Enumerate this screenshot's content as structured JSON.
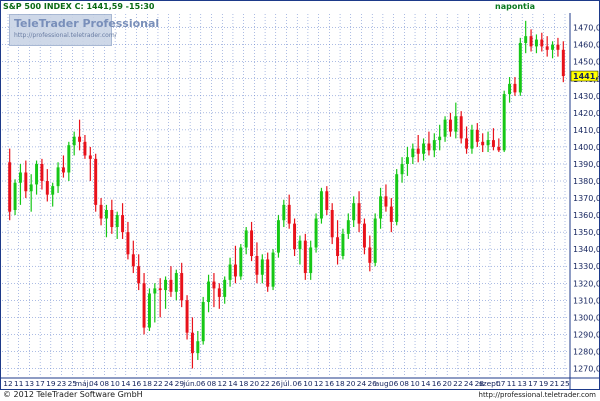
{
  "header": {
    "title": "S&P 500 INDEX C: 1441,59 -15:30",
    "period": "napontia"
  },
  "watermark": {
    "brand": "TeleTrader Professional",
    "url": "http://professional.teletrader.com/"
  },
  "footer": {
    "copyright": "© 2012 TeleTrader Software GmbH",
    "url": "http://professional.teletrader.com"
  },
  "colors": {
    "up": "#16c716",
    "down": "#e8111a",
    "grid": "#5a7ac8",
    "axis_text": "#15245e",
    "last_price_bg": "#ffff00"
  },
  "chart_data": {
    "type": "candlestick",
    "title": "S&P 500 INDEX",
    "last_price_label": "1441,59",
    "last_price": 1441.59,
    "ylim": [
      1265,
      1478
    ],
    "yticks": [
      "1270,00",
      "1280,00",
      "1290,00",
      "1300,00",
      "1310,00",
      "1320,00",
      "1330,00",
      "1340,00",
      "1350,00",
      "1360,00",
      "1370,00",
      "1380,00",
      "1390,00",
      "1400,00",
      "1410,00",
      "1420,00",
      "1430,00",
      "1440,00",
      "1450,00",
      "1460,00",
      "1470,00"
    ],
    "xticks": [
      "12",
      "11",
      "13",
      "17",
      "19",
      "23",
      "25",
      "máj.",
      "04",
      "08",
      "10",
      "14",
      "16",
      "18",
      "22",
      "24",
      "29",
      "jún.",
      "06",
      "08",
      "12",
      "14",
      "18",
      "20",
      "22",
      "26",
      "júl.",
      "06",
      "10",
      "12",
      "16",
      "18",
      "20",
      "24",
      "26",
      "aug.",
      "06",
      "08",
      "10",
      "14",
      "16",
      "20",
      "22",
      "24",
      "28",
      "szept.",
      "07",
      "11",
      "13",
      "17",
      "19",
      "21",
      "25"
    ],
    "grid": true,
    "ohlc": [
      [
        1391,
        1399,
        1357,
        1362
      ],
      [
        1363,
        1381,
        1360,
        1379
      ],
      [
        1379,
        1390,
        1366,
        1385
      ],
      [
        1385,
        1392,
        1370,
        1374
      ],
      [
        1374,
        1384,
        1362,
        1378
      ],
      [
        1378,
        1392,
        1372,
        1390
      ],
      [
        1390,
        1393,
        1375,
        1380
      ],
      [
        1380,
        1387,
        1368,
        1372
      ],
      [
        1372,
        1379,
        1365,
        1377
      ],
      [
        1377,
        1391,
        1373,
        1388
      ],
      [
        1388,
        1395,
        1382,
        1385
      ],
      [
        1385,
        1403,
        1380,
        1401
      ],
      [
        1401,
        1409,
        1395,
        1406
      ],
      [
        1406,
        1416,
        1398,
        1403
      ],
      [
        1403,
        1407,
        1393,
        1395
      ],
      [
        1395,
        1400,
        1380,
        1393
      ],
      [
        1393,
        1396,
        1362,
        1366
      ],
      [
        1366,
        1370,
        1354,
        1358
      ],
      [
        1358,
        1366,
        1347,
        1363
      ],
      [
        1363,
        1369,
        1349,
        1353
      ],
      [
        1353,
        1362,
        1346,
        1360
      ],
      [
        1360,
        1367,
        1346,
        1350
      ],
      [
        1350,
        1356,
        1334,
        1337
      ],
      [
        1337,
        1345,
        1326,
        1330
      ],
      [
        1330,
        1337,
        1316,
        1320
      ],
      [
        1320,
        1326,
        1290,
        1294
      ],
      [
        1294,
        1317,
        1292,
        1314
      ],
      [
        1314,
        1320,
        1297,
        1317
      ],
      [
        1317,
        1323,
        1300,
        1316
      ],
      [
        1316,
        1324,
        1305,
        1322
      ],
      [
        1322,
        1330,
        1312,
        1315
      ],
      [
        1315,
        1328,
        1310,
        1326
      ],
      [
        1326,
        1332,
        1306,
        1310
      ],
      [
        1310,
        1313,
        1287,
        1291
      ],
      [
        1291,
        1300,
        1270,
        1279
      ],
      [
        1279,
        1292,
        1275,
        1286
      ],
      [
        1286,
        1312,
        1284,
        1309
      ],
      [
        1309,
        1325,
        1303,
        1321
      ],
      [
        1321,
        1326,
        1306,
        1317
      ],
      [
        1317,
        1320,
        1305,
        1312
      ],
      [
        1312,
        1324,
        1308,
        1322
      ],
      [
        1322,
        1335,
        1318,
        1331
      ],
      [
        1331,
        1342,
        1320,
        1324
      ],
      [
        1324,
        1343,
        1322,
        1341
      ],
      [
        1341,
        1353,
        1337,
        1351
      ],
      [
        1351,
        1356,
        1333,
        1336
      ],
      [
        1336,
        1344,
        1320,
        1325
      ],
      [
        1325,
        1337,
        1320,
        1334
      ],
      [
        1334,
        1338,
        1315,
        1318
      ],
      [
        1318,
        1340,
        1316,
        1338
      ],
      [
        1338,
        1360,
        1335,
        1357
      ],
      [
        1357,
        1369,
        1353,
        1366
      ],
      [
        1366,
        1372,
        1352,
        1355
      ],
      [
        1355,
        1358,
        1336,
        1340
      ],
      [
        1340,
        1348,
        1331,
        1345
      ],
      [
        1345,
        1349,
        1322,
        1326
      ],
      [
        1326,
        1345,
        1322,
        1341
      ],
      [
        1341,
        1361,
        1338,
        1358
      ],
      [
        1358,
        1376,
        1355,
        1374
      ],
      [
        1374,
        1377,
        1360,
        1363
      ],
      [
        1363,
        1367,
        1343,
        1347
      ],
      [
        1347,
        1357,
        1331,
        1336
      ],
      [
        1336,
        1352,
        1334,
        1349
      ],
      [
        1349,
        1361,
        1346,
        1357
      ],
      [
        1357,
        1371,
        1353,
        1367
      ],
      [
        1367,
        1374,
        1350,
        1355
      ],
      [
        1355,
        1358,
        1337,
        1341
      ],
      [
        1341,
        1348,
        1327,
        1332
      ],
      [
        1332,
        1361,
        1330,
        1358
      ],
      [
        1358,
        1376,
        1352,
        1371
      ],
      [
        1371,
        1378,
        1362,
        1365
      ],
      [
        1365,
        1370,
        1350,
        1356
      ],
      [
        1356,
        1387,
        1354,
        1384
      ],
      [
        1384,
        1394,
        1379,
        1390
      ],
      [
        1390,
        1400,
        1383,
        1394
      ],
      [
        1394,
        1402,
        1390,
        1399
      ],
      [
        1399,
        1407,
        1391,
        1396
      ],
      [
        1396,
        1405,
        1392,
        1402
      ],
      [
        1402,
        1409,
        1395,
        1398
      ],
      [
        1398,
        1408,
        1394,
        1404
      ],
      [
        1404,
        1413,
        1398,
        1406
      ],
      [
        1406,
        1418,
        1403,
        1416
      ],
      [
        1416,
        1420,
        1406,
        1409
      ],
      [
        1409,
        1426,
        1405,
        1418
      ],
      [
        1418,
        1421,
        1402,
        1405
      ],
      [
        1405,
        1412,
        1396,
        1399
      ],
      [
        1399,
        1413,
        1396,
        1410
      ],
      [
        1410,
        1414,
        1400,
        1403
      ],
      [
        1403,
        1408,
        1397,
        1401
      ],
      [
        1401,
        1409,
        1397,
        1404
      ],
      [
        1404,
        1411,
        1398,
        1400
      ],
      [
        1400,
        1405,
        1397,
        1398
      ],
      [
        1398,
        1433,
        1397,
        1431
      ],
      [
        1431,
        1441,
        1426,
        1437
      ],
      [
        1437,
        1441,
        1430,
        1432
      ],
      [
        1432,
        1464,
        1430,
        1461
      ],
      [
        1461,
        1474,
        1455,
        1465
      ],
      [
        1465,
        1469,
        1456,
        1459
      ],
      [
        1459,
        1466,
        1455,
        1463
      ],
      [
        1463,
        1467,
        1456,
        1459
      ],
      [
        1459,
        1465,
        1453,
        1457
      ],
      [
        1457,
        1462,
        1452,
        1460
      ],
      [
        1460,
        1464,
        1453,
        1457
      ],
      [
        1457,
        1462,
        1438,
        1441.59
      ]
    ]
  }
}
